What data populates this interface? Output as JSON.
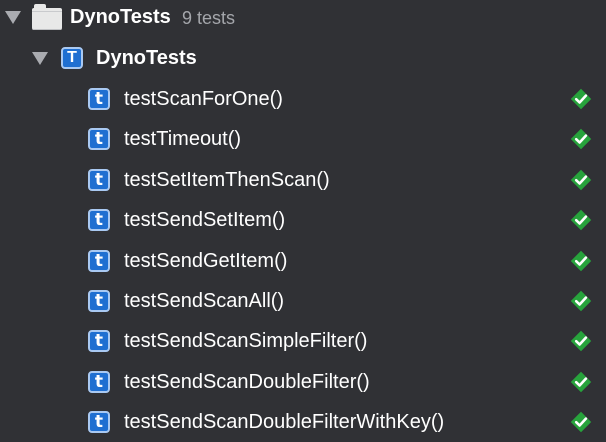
{
  "navigator": {
    "bundle": {
      "name": "DynoTests",
      "count_text": "9 tests",
      "icon": "folder-icon"
    },
    "target": {
      "name": "DynoTests",
      "icon_letter": "T"
    },
    "test_icon_letter": "t",
    "status_icon": "test-passed-icon",
    "status_color": "#27a33c",
    "tests": [
      {
        "name": "testScanForOne()"
      },
      {
        "name": "testTimeout()"
      },
      {
        "name": "testSetItemThenScan()"
      },
      {
        "name": "testSendSetItem()"
      },
      {
        "name": "testSendGetItem()"
      },
      {
        "name": "testSendScanAll()"
      },
      {
        "name": "testSendScanSimpleFilter()"
      },
      {
        "name": "testSendScanDoubleFilter()"
      },
      {
        "name": "testSendScanDoubleFilterWithKey()"
      }
    ]
  }
}
